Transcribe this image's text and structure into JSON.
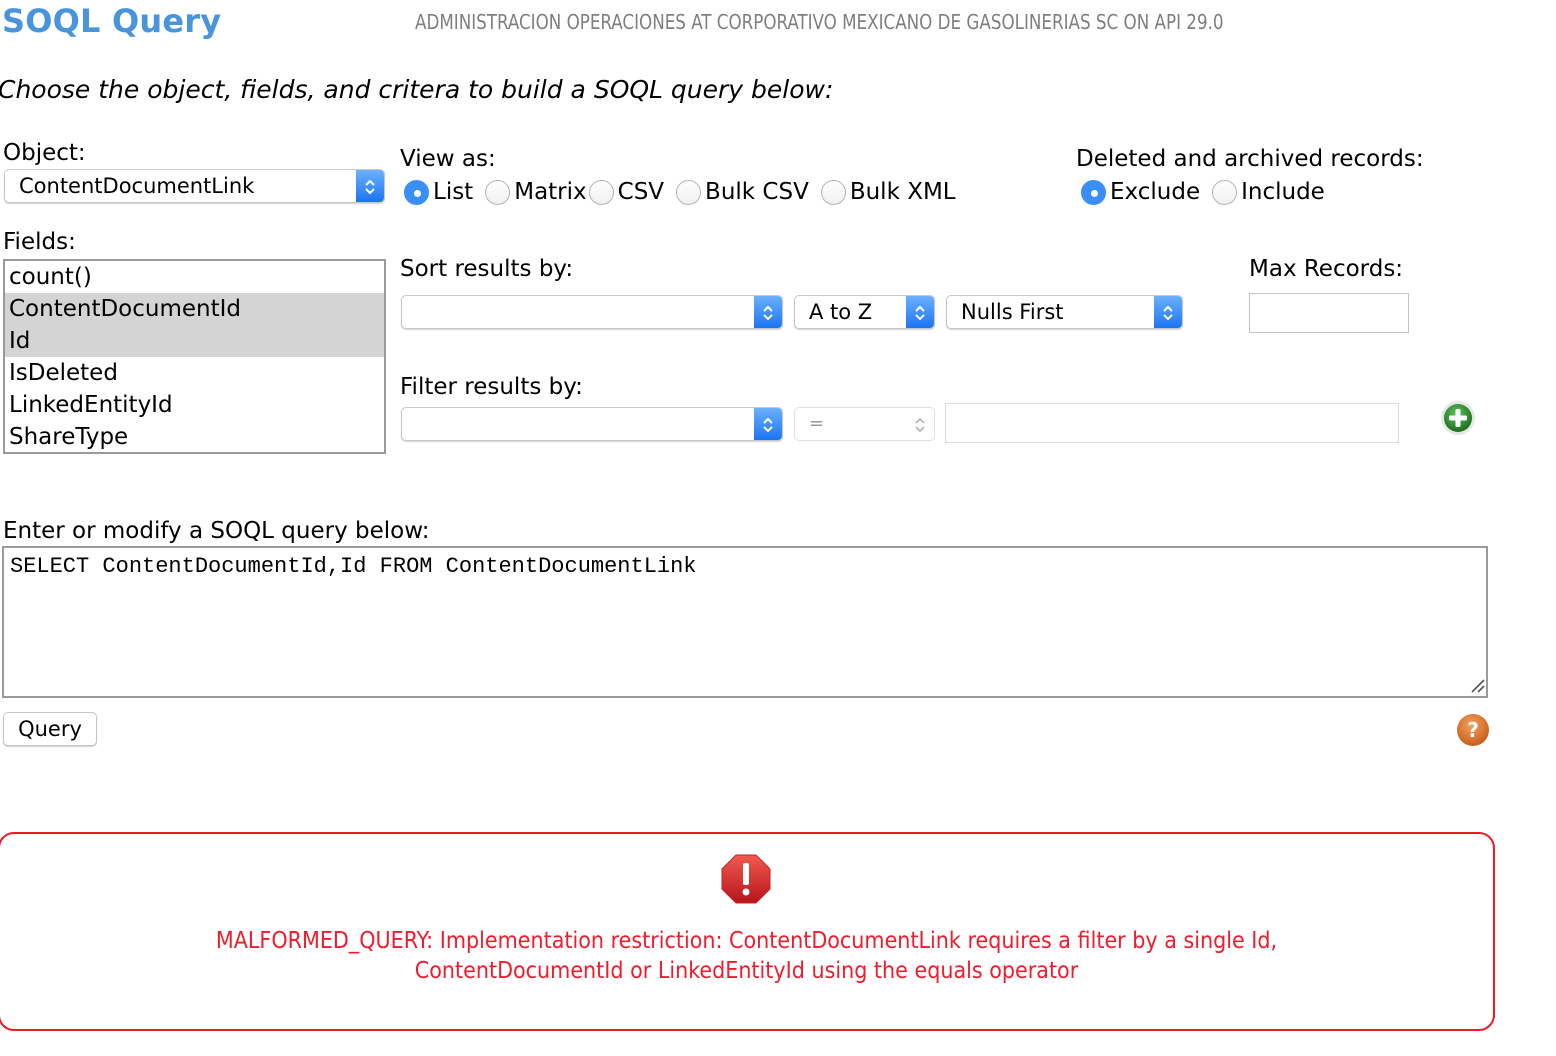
{
  "header": {
    "title": "SOQL Query",
    "org_info": "ADMINISTRACION OPERACIONES AT CORPORATIVO MEXICANO DE GASOLINERIAS SC ON API 29.0"
  },
  "instructions": "Choose the object, fields, and critera to build a SOQL query below:",
  "object": {
    "label": "Object:",
    "selected": "ContentDocumentLink"
  },
  "view_as": {
    "label": "View as:",
    "options": [
      {
        "label": "List",
        "checked": true
      },
      {
        "label": "Matrix",
        "checked": false
      },
      {
        "label": "CSV",
        "checked": false
      },
      {
        "label": "Bulk CSV",
        "checked": false
      },
      {
        "label": "Bulk XML",
        "checked": false
      }
    ]
  },
  "deleted_records": {
    "label": "Deleted and archived records:",
    "options": [
      {
        "label": "Exclude",
        "checked": true
      },
      {
        "label": "Include",
        "checked": false
      }
    ]
  },
  "fields": {
    "label": "Fields:",
    "items": [
      {
        "label": "count()",
        "selected": false
      },
      {
        "label": "ContentDocumentId",
        "selected": true
      },
      {
        "label": "Id",
        "selected": true
      },
      {
        "label": "IsDeleted",
        "selected": false
      },
      {
        "label": "LinkedEntityId",
        "selected": false
      },
      {
        "label": "ShareType",
        "selected": false
      }
    ]
  },
  "sort": {
    "label": "Sort results by:",
    "field": "",
    "direction": "A to Z",
    "nulls": "Nulls First"
  },
  "max_records": {
    "label": "Max Records:",
    "value": ""
  },
  "filter": {
    "label": "Filter results by:",
    "field": "",
    "operator": "=",
    "value": ""
  },
  "query": {
    "label": "Enter or modify a SOQL query below:",
    "text": "SELECT ContentDocumentId,Id FROM ContentDocumentLink",
    "button_label": "Query"
  },
  "error": {
    "line1": "MALFORMED_QUERY: Implementation restriction: ContentDocumentLink requires a filter by a single Id,",
    "line2": "ContentDocumentId or LinkedEntityId using the equals operator"
  },
  "colors": {
    "title": "#4a94dc",
    "error": "#ec1c24",
    "accent": "#3b8ef5"
  }
}
